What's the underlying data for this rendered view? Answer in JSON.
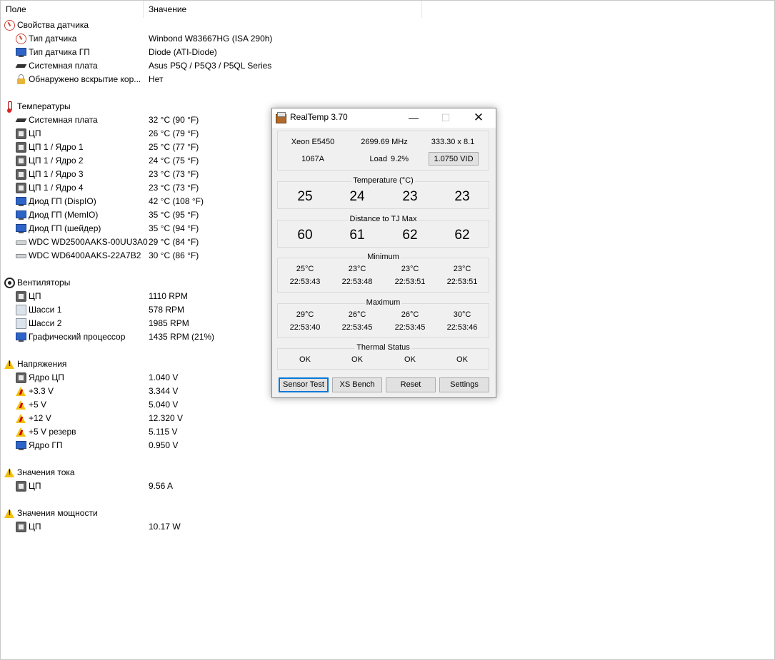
{
  "list": {
    "header": {
      "field": "Поле",
      "value": "Значение"
    }
  },
  "tree": {
    "sensor_props": {
      "label": "Свойства датчика",
      "items": [
        {
          "label": "Тип датчика",
          "value": "Winbond W83667HG  (ISA 290h)",
          "icon": "gauge-icon"
        },
        {
          "label": "Тип датчика ГП",
          "value": "Diode  (ATI-Diode)",
          "icon": "monitor-icon"
        },
        {
          "label": "Системная плата",
          "value": "Asus P5Q / P5Q3 / P5QL Series",
          "icon": "motherboard-icon"
        },
        {
          "label": "Обнаружено вскрытие кор...",
          "value": "Нет",
          "icon": "lock-icon"
        }
      ]
    },
    "temps": {
      "label": "Температуры",
      "items": [
        {
          "label": "Системная плата",
          "value": "32 °C  (90 °F)",
          "icon": "motherboard-icon"
        },
        {
          "label": "ЦП",
          "value": "26 °C  (79 °F)",
          "icon": "cpu-icon"
        },
        {
          "label": "ЦП 1 / Ядро 1",
          "value": "25 °C  (77 °F)",
          "icon": "cpu-icon"
        },
        {
          "label": "ЦП 1 / Ядро 2",
          "value": "24 °C  (75 °F)",
          "icon": "cpu-icon"
        },
        {
          "label": "ЦП 1 / Ядро 3",
          "value": "23 °C  (73 °F)",
          "icon": "cpu-icon"
        },
        {
          "label": "ЦП 1 / Ядро 4",
          "value": "23 °C  (73 °F)",
          "icon": "cpu-icon"
        },
        {
          "label": "Диод ГП (DispIO)",
          "value": "42 °C  (108 °F)",
          "icon": "monitor-icon"
        },
        {
          "label": "Диод ГП (MemIO)",
          "value": "35 °C  (95 °F)",
          "icon": "monitor-icon"
        },
        {
          "label": "Диод ГП (шейдер)",
          "value": "35 °C  (94 °F)",
          "icon": "monitor-icon"
        },
        {
          "label": "WDC WD2500AAKS-00UU3A0",
          "value": "29 °C  (84 °F)",
          "icon": "hdd-icon"
        },
        {
          "label": "WDC WD6400AAKS-22A7B2",
          "value": "30 °C  (86 °F)",
          "icon": "hdd-icon"
        }
      ]
    },
    "fans": {
      "label": "Вентиляторы",
      "items": [
        {
          "label": "ЦП",
          "value": "1110 RPM",
          "icon": "cpu-icon"
        },
        {
          "label": "Шасси 1",
          "value": "578 RPM",
          "icon": "case-icon"
        },
        {
          "label": "Шасси 2",
          "value": "1985 RPM",
          "icon": "case-icon"
        },
        {
          "label": "Графический процессор",
          "value": "1435 RPM  (21%)",
          "icon": "monitor-icon"
        }
      ]
    },
    "voltages": {
      "label": "Напряжения",
      "items": [
        {
          "label": "Ядро ЦП",
          "value": "1.040 V",
          "icon": "cpu-icon"
        },
        {
          "label": "+3.3 V",
          "value": "3.344 V",
          "icon": "voltage-warning-icon"
        },
        {
          "label": "+5 V",
          "value": "5.040 V",
          "icon": "voltage-warning-icon"
        },
        {
          "label": "+12 V",
          "value": "12.320 V",
          "icon": "voltage-warning-icon"
        },
        {
          "label": "+5 V резерв",
          "value": "5.115 V",
          "icon": "voltage-warning-icon"
        },
        {
          "label": "Ядро ГП",
          "value": "0.950 V",
          "icon": "monitor-icon"
        }
      ]
    },
    "currents": {
      "label": "Значения тока",
      "items": [
        {
          "label": "ЦП",
          "value": "9.56 A",
          "icon": "cpu-icon"
        }
      ]
    },
    "powers": {
      "label": "Значения мощности",
      "items": [
        {
          "label": "ЦП",
          "value": "10.17 W",
          "icon": "cpu-icon"
        }
      ]
    }
  },
  "realtemp": {
    "title": "RealTemp 3.70",
    "window_controls": {
      "minimize": "—",
      "maximize": "☐",
      "close": "✕"
    },
    "cpu": {
      "model": "Xeon E5450",
      "clock": "2699.69 MHz",
      "multiplier": "333.30 x 8.1",
      "stepping": "1067A",
      "load_label": "Load",
      "load_value": "9.2%",
      "vid": "1.0750 VID"
    },
    "temperature": {
      "title": "Temperature (°C)",
      "values": [
        "25",
        "24",
        "23",
        "23"
      ]
    },
    "distance": {
      "title": "Distance to TJ Max",
      "values": [
        "60",
        "61",
        "62",
        "62"
      ]
    },
    "minimum": {
      "title": "Minimum",
      "temps": [
        "25°C",
        "23°C",
        "23°C",
        "23°C"
      ],
      "times": [
        "22:53:43",
        "22:53:48",
        "22:53:51",
        "22:53:51"
      ]
    },
    "maximum": {
      "title": "Maximum",
      "temps": [
        "29°C",
        "26°C",
        "26°C",
        "30°C"
      ],
      "times": [
        "22:53:40",
        "22:53:45",
        "22:53:45",
        "22:53:46"
      ]
    },
    "thermal": {
      "title": "Thermal Status",
      "values": [
        "OK",
        "OK",
        "OK",
        "OK"
      ]
    },
    "buttons": {
      "sensor_test": "Sensor Test",
      "xs_bench": "XS Bench",
      "reset": "Reset",
      "settings": "Settings"
    }
  }
}
